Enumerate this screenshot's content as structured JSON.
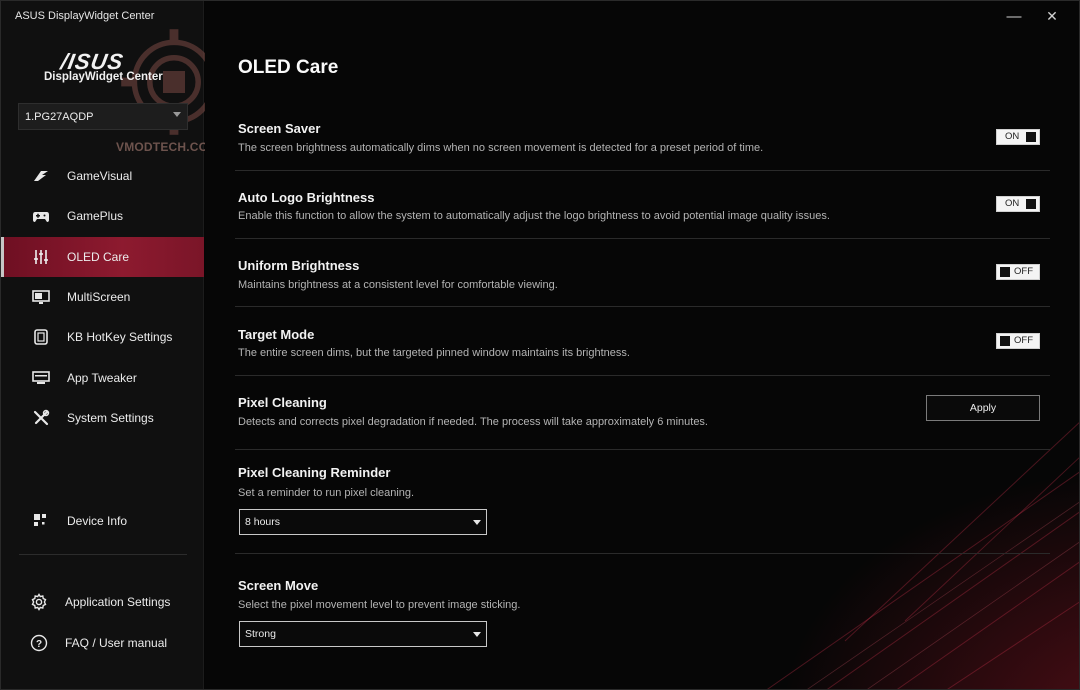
{
  "window": {
    "title": "ASUS DisplayWidget Center",
    "minimize_symbol": "—",
    "close_symbol": "✕"
  },
  "sidebar": {
    "logo_text": "/ISUS",
    "logo_subtitle": "DisplayWidget Center",
    "watermark": "VMODTECH.COM",
    "device_selector": {
      "value": "1.PG27AQDP"
    },
    "items": [
      {
        "label": "GameVisual",
        "icon": "gamevisual-icon",
        "active": false
      },
      {
        "label": "GamePlus",
        "icon": "gamepad-icon",
        "active": false
      },
      {
        "label": "OLED Care",
        "icon": "sliders-icon",
        "active": true
      },
      {
        "label": "MultiScreen",
        "icon": "monitor-icon",
        "active": false
      },
      {
        "label": "KB HotKey Settings",
        "icon": "keyboard-icon",
        "active": false
      },
      {
        "label": "App Tweaker",
        "icon": "app-tweaker-icon",
        "active": false
      },
      {
        "label": "System Settings",
        "icon": "tools-icon",
        "active": false
      }
    ],
    "device_info": {
      "label": "Device Info",
      "icon": "grid-icon"
    },
    "bottom": [
      {
        "label": "Application Settings",
        "icon": "gear-icon"
      },
      {
        "label": "FAQ / User manual",
        "icon": "help-icon"
      }
    ]
  },
  "main": {
    "title": "OLED Care",
    "screen_saver": {
      "title": "Screen Saver",
      "description": "The screen brightness automatically dims when no screen movement is detected for a preset period of time.",
      "toggle": "ON"
    },
    "auto_logo": {
      "title": "Auto Logo Brightness",
      "description": "Enable this function to allow the system to automatically adjust the logo brightness to avoid potential image quality issues.",
      "toggle": "ON"
    },
    "uniform": {
      "title": "Uniform Brightness",
      "description": "Maintains brightness at a consistent level for comfortable viewing.",
      "toggle": "OFF"
    },
    "target_mode": {
      "title": "Target Mode",
      "description": "The entire screen dims, but the targeted pinned window maintains its brightness.",
      "toggle": "OFF"
    },
    "pixel_cleaning": {
      "title": "Pixel Cleaning",
      "description": "Detects and corrects pixel degradation if needed. The process will take approximately 6 minutes.",
      "button": "Apply"
    },
    "pixel_reminder": {
      "title": "Pixel Cleaning Reminder",
      "description": "Set a reminder to run pixel cleaning.",
      "selected": "8 hours"
    },
    "screen_move": {
      "title": "Screen Move",
      "description": "Select the pixel movement level to prevent image sticking.",
      "selected": "Strong"
    }
  },
  "colors": {
    "accent": "#8d1a2f",
    "background": "#060606",
    "sidebar": "#101010"
  }
}
